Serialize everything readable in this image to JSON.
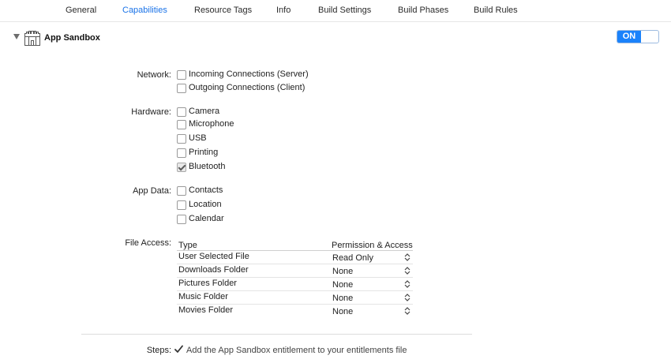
{
  "tabs": [
    {
      "label": "General",
      "active": false
    },
    {
      "label": "Capabilities",
      "active": true
    },
    {
      "label": "Resource Tags",
      "active": false
    },
    {
      "label": "Info",
      "active": false
    },
    {
      "label": "Build Settings",
      "active": false
    },
    {
      "label": "Build Phases",
      "active": false
    },
    {
      "label": "Build Rules",
      "active": false
    }
  ],
  "section": {
    "title": "App Sandbox",
    "icon": "castle-icon",
    "toggle_label": "ON"
  },
  "network": {
    "label": "Network:",
    "options": [
      {
        "label": "Incoming Connections (Server)",
        "checked": false
      },
      {
        "label": "Outgoing Connections (Client)",
        "checked": false
      }
    ]
  },
  "hardware": {
    "label": "Hardware:",
    "options": [
      {
        "label": "Camera",
        "checked": false
      },
      {
        "label": "Microphone",
        "checked": false
      },
      {
        "label": "USB",
        "checked": false
      },
      {
        "label": "Printing",
        "checked": false
      },
      {
        "label": "Bluetooth",
        "checked": true
      }
    ]
  },
  "app_data": {
    "label": "App Data:",
    "options": [
      {
        "label": "Contacts",
        "checked": false
      },
      {
        "label": "Location",
        "checked": false
      },
      {
        "label": "Calendar",
        "checked": false
      }
    ]
  },
  "file_access": {
    "label": "File Access:",
    "col_type": "Type",
    "col_permission": "Permission & Access",
    "rows": [
      {
        "type": "User Selected File",
        "permission": "Read Only"
      },
      {
        "type": "Downloads Folder",
        "permission": "None"
      },
      {
        "type": "Pictures Folder",
        "permission": "None"
      },
      {
        "type": "Music Folder",
        "permission": "None"
      },
      {
        "type": "Movies Folder",
        "permission": "None"
      }
    ]
  },
  "steps": {
    "label": "Steps:",
    "items": [
      {
        "text": "Add the App Sandbox entitlement to your entitlements file",
        "done": true
      }
    ]
  },
  "colors": {
    "accent": "#1a82fb",
    "active_tab": "#1a73e8"
  }
}
